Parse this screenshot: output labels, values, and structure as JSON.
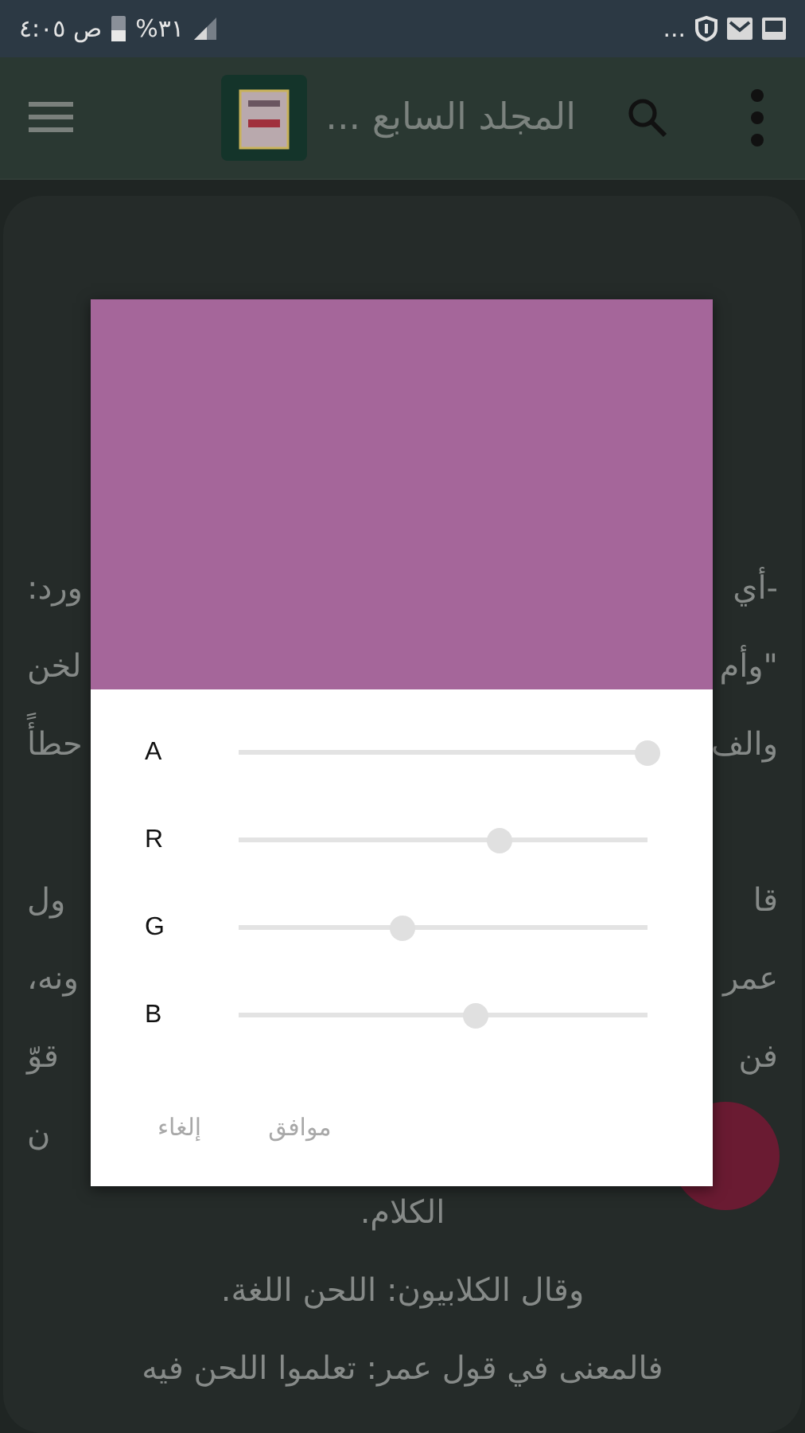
{
  "status_bar": {
    "time": "ص ٤:٠٥",
    "battery": "%٣١",
    "more": "..."
  },
  "app_bar": {
    "title": "المجلد السابع ..."
  },
  "background_text": [
    {
      "right": "-أي",
      "left": "ورد:"
    },
    {
      "right": "\"وأم",
      "left": "لخن"
    },
    {
      "right": "والف",
      "left": "حطأً"
    },
    {
      "right": "قا",
      "left": "ول",
      "paragraph_start": true
    },
    {
      "right": "عمر",
      "left": "ونه،"
    },
    {
      "right": "فن",
      "left": "قوّ"
    },
    {
      "left": "ن"
    },
    {
      "full": "الكلام."
    },
    {
      "full": "وقال الكلابيون: اللحن اللغة."
    },
    {
      "full": "فالمعنى في قول عمر: تعلموا اللحن فيه"
    }
  ],
  "dialog": {
    "preview": {
      "color": "#a5669a"
    },
    "channels": [
      {
        "label": "A",
        "level": 1.0
      },
      {
        "label": "R",
        "level": 0.64
      },
      {
        "label": "G",
        "level": 0.4
      },
      {
        "label": "B",
        "level": 0.58
      }
    ],
    "buttons": [
      {
        "label": "موافق",
        "disabled": true
      },
      {
        "label": "إلغاء",
        "disabled": true
      }
    ]
  }
}
